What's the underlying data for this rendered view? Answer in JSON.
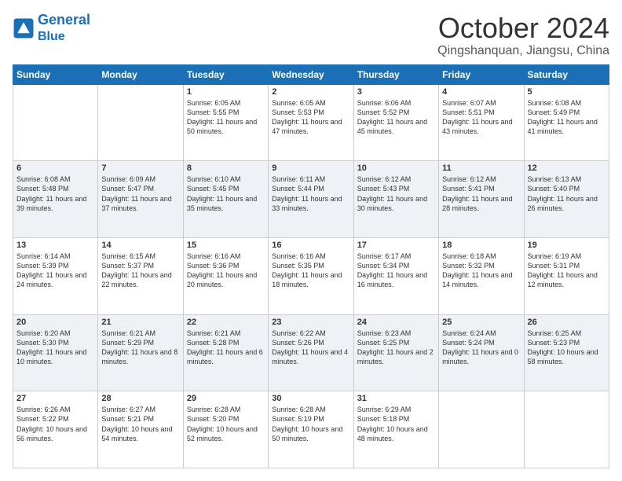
{
  "logo": {
    "line1": "General",
    "line2": "Blue"
  },
  "header": {
    "title": "October 2024",
    "subtitle": "Qingshanquan, Jiangsu, China"
  },
  "days_of_week": [
    "Sunday",
    "Monday",
    "Tuesday",
    "Wednesday",
    "Thursday",
    "Friday",
    "Saturday"
  ],
  "weeks": [
    [
      {
        "day": "",
        "info": ""
      },
      {
        "day": "",
        "info": ""
      },
      {
        "day": "1",
        "info": "Sunrise: 6:05 AM\nSunset: 5:55 PM\nDaylight: 11 hours and 50 minutes."
      },
      {
        "day": "2",
        "info": "Sunrise: 6:05 AM\nSunset: 5:53 PM\nDaylight: 11 hours and 47 minutes."
      },
      {
        "day": "3",
        "info": "Sunrise: 6:06 AM\nSunset: 5:52 PM\nDaylight: 11 hours and 45 minutes."
      },
      {
        "day": "4",
        "info": "Sunrise: 6:07 AM\nSunset: 5:51 PM\nDaylight: 11 hours and 43 minutes."
      },
      {
        "day": "5",
        "info": "Sunrise: 6:08 AM\nSunset: 5:49 PM\nDaylight: 11 hours and 41 minutes."
      }
    ],
    [
      {
        "day": "6",
        "info": "Sunrise: 6:08 AM\nSunset: 5:48 PM\nDaylight: 11 hours and 39 minutes."
      },
      {
        "day": "7",
        "info": "Sunrise: 6:09 AM\nSunset: 5:47 PM\nDaylight: 11 hours and 37 minutes."
      },
      {
        "day": "8",
        "info": "Sunrise: 6:10 AM\nSunset: 5:45 PM\nDaylight: 11 hours and 35 minutes."
      },
      {
        "day": "9",
        "info": "Sunrise: 6:11 AM\nSunset: 5:44 PM\nDaylight: 11 hours and 33 minutes."
      },
      {
        "day": "10",
        "info": "Sunrise: 6:12 AM\nSunset: 5:43 PM\nDaylight: 11 hours and 30 minutes."
      },
      {
        "day": "11",
        "info": "Sunrise: 6:12 AM\nSunset: 5:41 PM\nDaylight: 11 hours and 28 minutes."
      },
      {
        "day": "12",
        "info": "Sunrise: 6:13 AM\nSunset: 5:40 PM\nDaylight: 11 hours and 26 minutes."
      }
    ],
    [
      {
        "day": "13",
        "info": "Sunrise: 6:14 AM\nSunset: 5:39 PM\nDaylight: 11 hours and 24 minutes."
      },
      {
        "day": "14",
        "info": "Sunrise: 6:15 AM\nSunset: 5:37 PM\nDaylight: 11 hours and 22 minutes."
      },
      {
        "day": "15",
        "info": "Sunrise: 6:16 AM\nSunset: 5:36 PM\nDaylight: 11 hours and 20 minutes."
      },
      {
        "day": "16",
        "info": "Sunrise: 6:16 AM\nSunset: 5:35 PM\nDaylight: 11 hours and 18 minutes."
      },
      {
        "day": "17",
        "info": "Sunrise: 6:17 AM\nSunset: 5:34 PM\nDaylight: 11 hours and 16 minutes."
      },
      {
        "day": "18",
        "info": "Sunrise: 6:18 AM\nSunset: 5:32 PM\nDaylight: 11 hours and 14 minutes."
      },
      {
        "day": "19",
        "info": "Sunrise: 6:19 AM\nSunset: 5:31 PM\nDaylight: 11 hours and 12 minutes."
      }
    ],
    [
      {
        "day": "20",
        "info": "Sunrise: 6:20 AM\nSunset: 5:30 PM\nDaylight: 11 hours and 10 minutes."
      },
      {
        "day": "21",
        "info": "Sunrise: 6:21 AM\nSunset: 5:29 PM\nDaylight: 11 hours and 8 minutes."
      },
      {
        "day": "22",
        "info": "Sunrise: 6:21 AM\nSunset: 5:28 PM\nDaylight: 11 hours and 6 minutes."
      },
      {
        "day": "23",
        "info": "Sunrise: 6:22 AM\nSunset: 5:26 PM\nDaylight: 11 hours and 4 minutes."
      },
      {
        "day": "24",
        "info": "Sunrise: 6:23 AM\nSunset: 5:25 PM\nDaylight: 11 hours and 2 minutes."
      },
      {
        "day": "25",
        "info": "Sunrise: 6:24 AM\nSunset: 5:24 PM\nDaylight: 11 hours and 0 minutes."
      },
      {
        "day": "26",
        "info": "Sunrise: 6:25 AM\nSunset: 5:23 PM\nDaylight: 10 hours and 58 minutes."
      }
    ],
    [
      {
        "day": "27",
        "info": "Sunrise: 6:26 AM\nSunset: 5:22 PM\nDaylight: 10 hours and 56 minutes."
      },
      {
        "day": "28",
        "info": "Sunrise: 6:27 AM\nSunset: 5:21 PM\nDaylight: 10 hours and 54 minutes."
      },
      {
        "day": "29",
        "info": "Sunrise: 6:28 AM\nSunset: 5:20 PM\nDaylight: 10 hours and 52 minutes."
      },
      {
        "day": "30",
        "info": "Sunrise: 6:28 AM\nSunset: 5:19 PM\nDaylight: 10 hours and 50 minutes."
      },
      {
        "day": "31",
        "info": "Sunrise: 6:29 AM\nSunset: 5:18 PM\nDaylight: 10 hours and 48 minutes."
      },
      {
        "day": "",
        "info": ""
      },
      {
        "day": "",
        "info": ""
      }
    ]
  ]
}
